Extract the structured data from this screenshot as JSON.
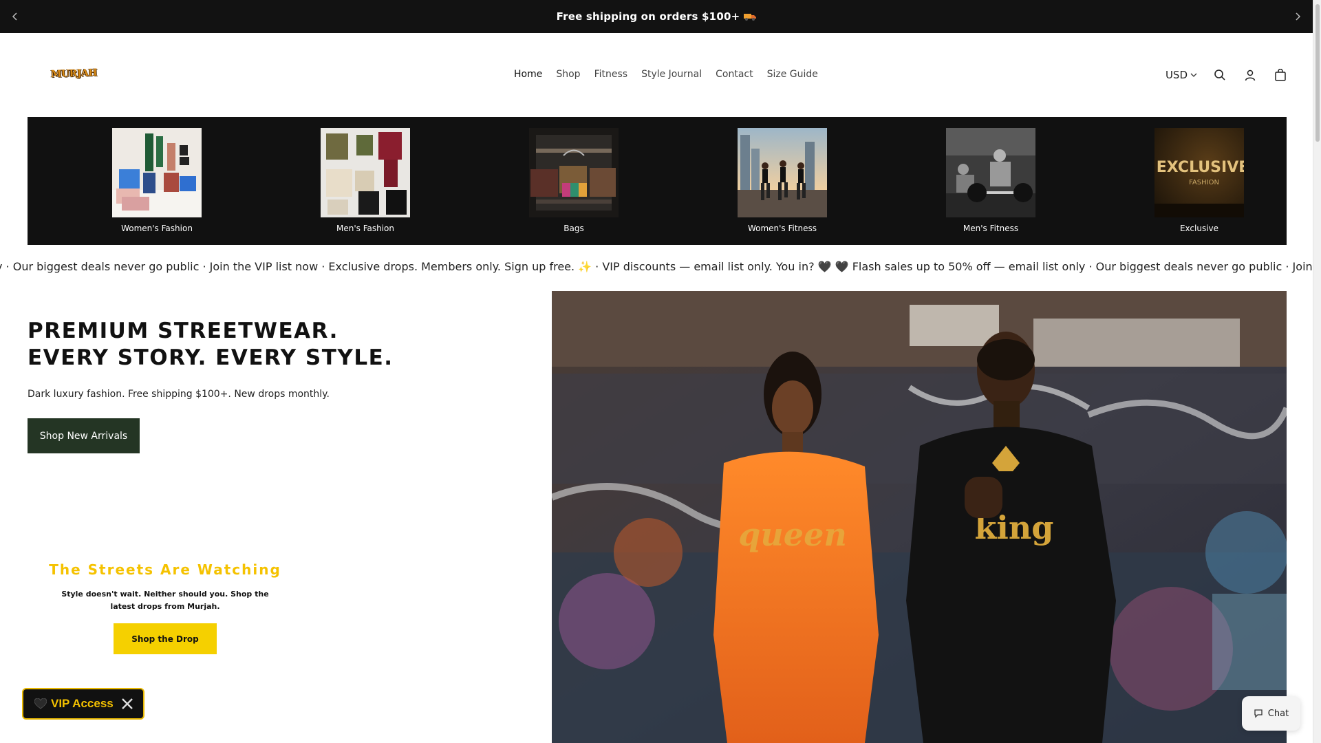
{
  "announcement": {
    "text": "Free shipping on orders $100+"
  },
  "header": {
    "logo_text": "MURJAH",
    "nav": [
      {
        "label": "Home",
        "active": true
      },
      {
        "label": "Shop"
      },
      {
        "label": "Fitness"
      },
      {
        "label": "Style Journal"
      },
      {
        "label": "Contact"
      },
      {
        "label": "Size Guide"
      }
    ],
    "currency": "USD"
  },
  "categories": [
    {
      "label": "Women's Fashion"
    },
    {
      "label": "Men's Fashion"
    },
    {
      "label": "Bags"
    },
    {
      "label": "Women's Fitness"
    },
    {
      "label": "Men's Fitness"
    },
    {
      "label": "Exclusive",
      "overlay_title": "EXCLUSIVE",
      "overlay_sub": "FASHION"
    }
  ],
  "marquee": {
    "text": "y · Our biggest deals never go public · Join the VIP list now · Exclusive drops. Members only. Sign up free. ✨ · VIP discounts — email list only. You in? 🖤     🖤 Flash sales up to 50% off — email list only · Our biggest deals never go public · Join the VIP list now · Exclusive drops. Members o"
  },
  "hero": {
    "title_line1": "PREMIUM STREETWEAR.",
    "title_line2": "EVERY STORY. EVERY STYLE.",
    "subtitle": "Dark luxury fashion. Free shipping $100+. New drops monthly.",
    "cta": "Shop New Arrivals",
    "image_text_left": "queen",
    "image_text_right": "king"
  },
  "promo": {
    "title": "The Streets Are Watching",
    "text": "Style doesn't wait. Neither should you. Shop the latest drops from Murjah.",
    "cta": "Shop the Drop"
  },
  "vip": {
    "label": "VIP Access"
  },
  "chat": {
    "label": "Chat"
  },
  "colors": {
    "topbar": "#121212",
    "cta_green": "#243524",
    "promo_yellow": "#f5c200",
    "drop_button": "#f5d000"
  }
}
